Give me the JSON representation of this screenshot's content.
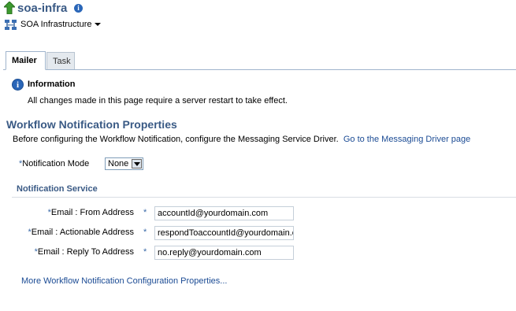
{
  "header": {
    "title": "soa-infra",
    "context_menu_label": "SOA Infrastructure"
  },
  "tabs": [
    {
      "label": "Mailer",
      "selected": true
    },
    {
      "label": "Task",
      "selected": false
    }
  ],
  "information": {
    "title": "Information",
    "text": "All changes made in this page require a server restart to take effect."
  },
  "section": {
    "title": "Workflow Notification Properties",
    "description": "Before configuring the Workflow Notification, configure the Messaging Service Driver.",
    "driver_link": "Go to the Messaging Driver page"
  },
  "notification_mode": {
    "required_mark": "*",
    "label": "Notification Mode",
    "value": "None"
  },
  "notification_service": {
    "title": "Notification Service",
    "fields": [
      {
        "required_mark": "*",
        "label": "Email : From Address",
        "star": "*",
        "value": "accountId@yourdomain.com"
      },
      {
        "required_mark": "*",
        "label": "Email : Actionable Address",
        "star": "*",
        "value": "respondToaccountId@yourdomain.com"
      },
      {
        "required_mark": "*",
        "label": "Email : Reply To Address",
        "star": "*",
        "value": "no.reply@yourdomain.com"
      }
    ]
  },
  "more_link": "More Workflow Notification Configuration Properties...",
  "colors": {
    "heading": "#3a5a85",
    "link": "#1b4b94",
    "info_icon": "#2a66b8",
    "tab_border": "#9fb4cc"
  },
  "icons": [
    "up-arrow-icon",
    "info-icon",
    "soa-infrastructure-icon",
    "chevron-down-icon"
  ]
}
